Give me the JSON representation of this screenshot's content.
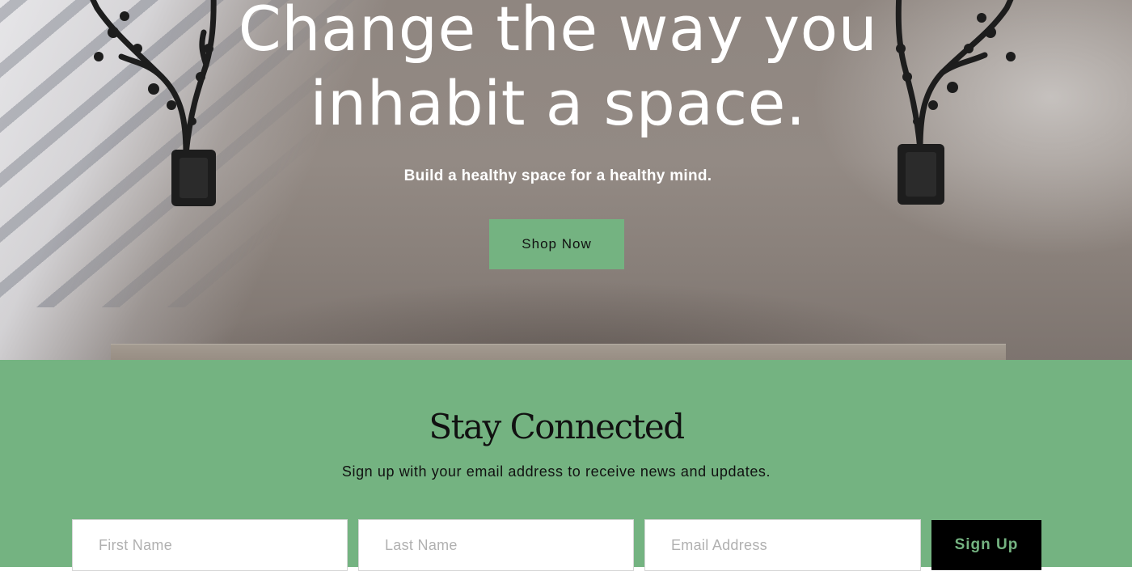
{
  "hero": {
    "title": "Change the way you inhabit a space.",
    "subtitle": "Build a healthy space for a healthy mind.",
    "cta_label": "Shop Now",
    "background_icon": "wall-sconce-photo"
  },
  "newsletter": {
    "title": "Stay Connected",
    "description": "Sign up with your email address to receive news and updates.",
    "first_name_placeholder": "First Name",
    "last_name_placeholder": "Last Name",
    "email_placeholder": "Email Address",
    "submit_label": "Sign Up"
  },
  "colors": {
    "accent_green": "#74b381",
    "button_dark": "#000000",
    "hero_text": "#ffffff"
  }
}
